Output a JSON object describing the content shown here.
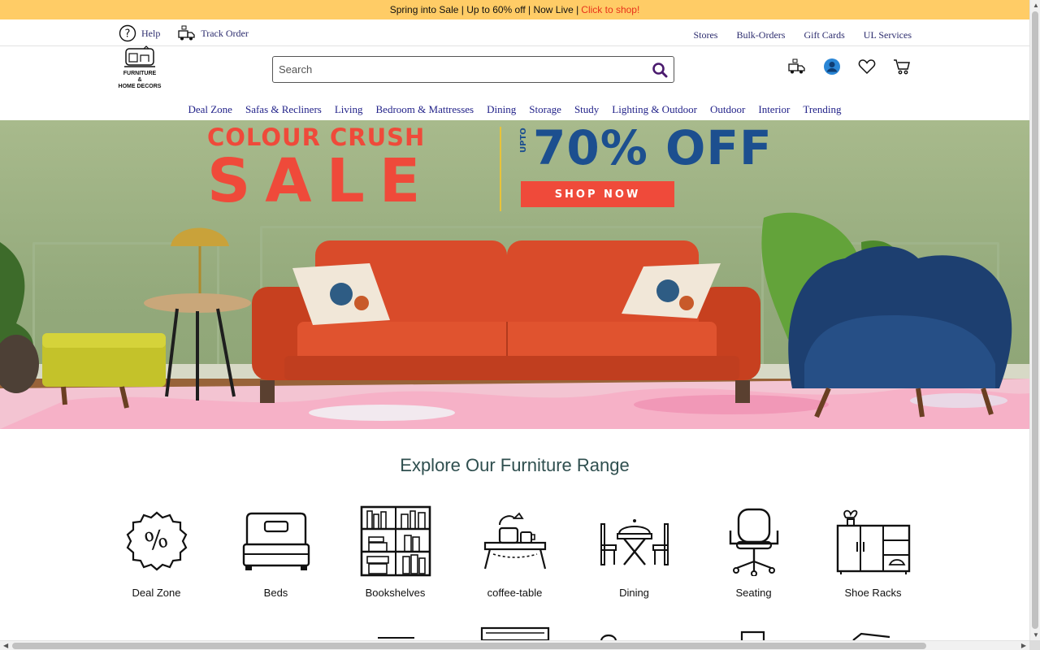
{
  "promo": {
    "text": "Spring into Sale | Up to 60% off | Now Live |",
    "cta": "Click to shop!"
  },
  "utility": {
    "help": "Help",
    "track_order": "Track Order",
    "links": [
      "Stores",
      "Bulk-Orders",
      "Gift Cards",
      "UL Services"
    ]
  },
  "logo": {
    "line1": "FURNITURE",
    "line2": "&",
    "line3": "HOME DECORS"
  },
  "search": {
    "placeholder": "Search",
    "value": ""
  },
  "nav": [
    "Deal Zone",
    "Safas & Recliners",
    "Living",
    "Bedroom & Mattresses",
    "Dining",
    "Storage",
    "Study",
    "Lighting & Outdoor",
    "Outdoor",
    "Interior",
    "Trending"
  ],
  "hero": {
    "line1": "COLOUR CRUSH",
    "line2": "SALE",
    "upto": "UPTO",
    "discount": "70% OFF",
    "button": "SHOP NOW"
  },
  "section_title": "Explore Our Furniture Range",
  "categories": [
    {
      "label": "Deal Zone",
      "icon": "discount-badge-icon"
    },
    {
      "label": "Beds",
      "icon": "bed-icon"
    },
    {
      "label": "Bookshelves",
      "icon": "bookshelf-icon"
    },
    {
      "label": "coffee-table",
      "icon": "coffee-table-icon"
    },
    {
      "label": "Dining",
      "icon": "dining-icon"
    },
    {
      "label": "Seating",
      "icon": "office-chair-icon"
    },
    {
      "label": "Shoe Racks",
      "icon": "shoe-rack-icon"
    }
  ],
  "colors": {
    "promo_bg": "#ffcc66",
    "cta": "#e8321a",
    "nav_text": "#23238a",
    "sale_red": "#ef4a3a",
    "sale_blue": "#1c4f8f"
  }
}
